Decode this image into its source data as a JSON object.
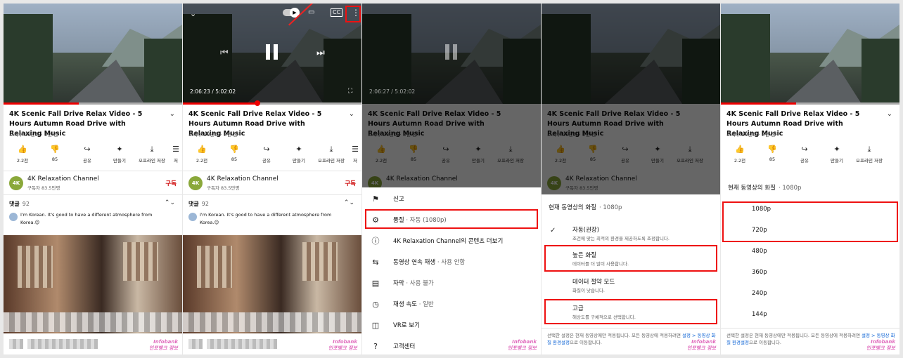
{
  "video": {
    "title": "4K Scenic Fall Drive Relax Video - 5 Hours Autumn Road Drive with Relaxing Music",
    "meta": "조회수 20만회 · 3년 전",
    "time_current": "2:06:23",
    "time_total": "5:02:02",
    "time_display": "2:06:23 / 5:02:02",
    "time_display_p3": "2:06:27 / 5:02:02",
    "progress_fraction": 0.42
  },
  "actions": [
    {
      "label": "2.2천",
      "icon": "like-icon"
    },
    {
      "label": "85",
      "icon": "dislike-icon"
    },
    {
      "label": "공유",
      "icon": "share-icon"
    },
    {
      "label": "만들기",
      "icon": "remix-icon"
    },
    {
      "label": "오프라인 저장",
      "icon": "download-icon"
    },
    {
      "label": "저",
      "icon": "save-icon"
    }
  ],
  "channel": {
    "name": "4K Relaxation Channel",
    "subscribers": "구독자 83.5만명",
    "avatar_text": "4K",
    "subscribe_label": "구독"
  },
  "comments": {
    "header": "댓글",
    "count": "92",
    "top_comment": "I'm Korean. It's good to have a different atmosphere from Korea.😉"
  },
  "watermark": {
    "line1": "Infobank",
    "line2": "인포뱅크 정보"
  },
  "menu": [
    {
      "label": "신고",
      "value": "",
      "icon": "flag-icon"
    },
    {
      "label": "품질",
      "value": "자동 (1080p)",
      "icon": "gear-icon"
    },
    {
      "label": "4K Relaxation Channel의 콘텐츠 더보기",
      "value": "",
      "icon": "info-icon"
    },
    {
      "label": "동영상 연속 재생",
      "value": "사용 안함",
      "icon": "loop-icon"
    },
    {
      "label": "자막",
      "value": "사용 불가",
      "icon": "captions-icon"
    },
    {
      "label": "재생 속도",
      "value": "일반",
      "icon": "playback-speed-icon"
    },
    {
      "label": "VR로 보기",
      "value": "",
      "icon": "vr-icon"
    },
    {
      "label": "고객센터",
      "value": "",
      "icon": "help-icon"
    }
  ],
  "quality_sheet": {
    "header": "현재 동영상의 화질",
    "current": "1080p",
    "options": [
      {
        "label": "자동(권장)",
        "desc": "조건에 맞는 최적의 환경을 제공하도록 조정합니다.",
        "checked": true
      },
      {
        "label": "높은 화질",
        "desc": "데이터를 더 많이 사용합니다.",
        "checked": false
      },
      {
        "label": "데이터 절약 모드",
        "desc": "화질이 낮습니다.",
        "checked": false
      },
      {
        "label": "고급",
        "desc": "해상도를 구체적으로 선택합니다.",
        "checked": false
      }
    ],
    "note_text": "선택한 설정은 현재 동영상에만 적용됩니다. 모든 동영상에 적용하려면",
    "note_link": "설정 > 동영상 화질 환경설정",
    "note_tail": "으로 이동합니다."
  },
  "advanced_sheet": {
    "header": "현재 동영상의 화질",
    "current": "1080p",
    "resolutions": [
      "1080p",
      "720p",
      "480p",
      "360p",
      "240p",
      "144p"
    ]
  },
  "colors": {
    "accent_red": "#e11111",
    "link_blue": "#065fd4",
    "subscribe_red": "#cc0000"
  }
}
